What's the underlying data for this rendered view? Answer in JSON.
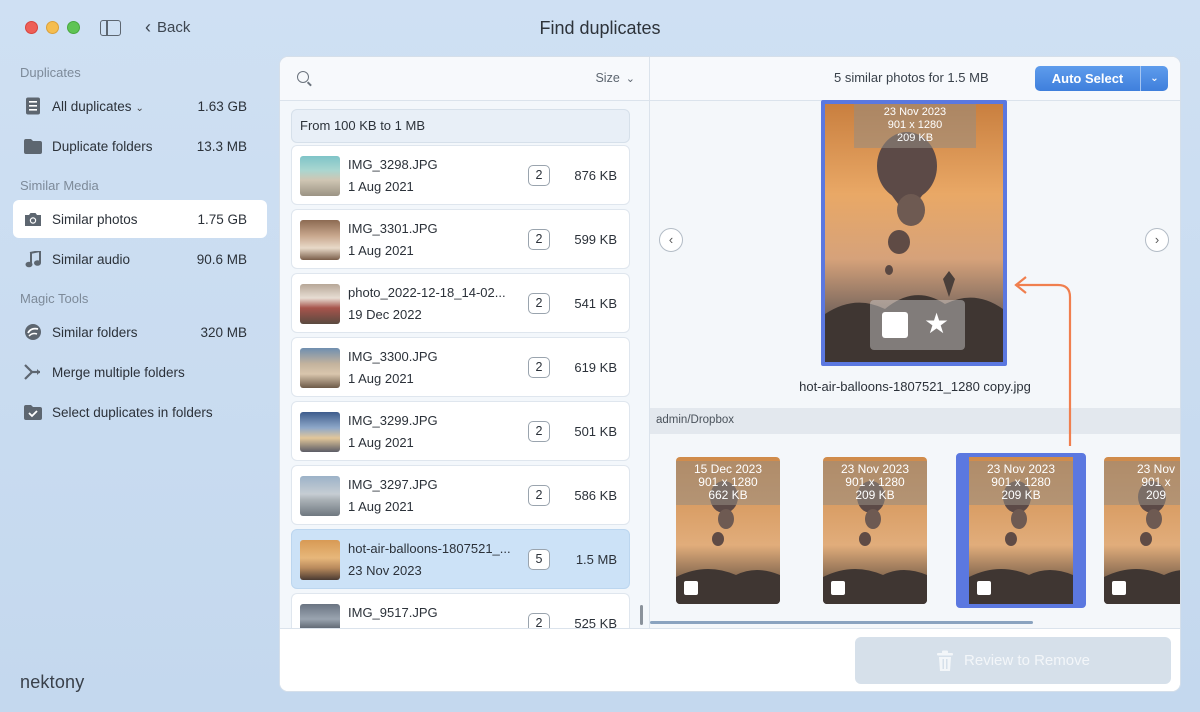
{
  "window": {
    "title": "Find duplicates",
    "back_label": "Back"
  },
  "sidebar": {
    "section_duplicates": "Duplicates",
    "section_similar": "Similar Media",
    "section_magic": "Magic Tools",
    "items": [
      {
        "label": "All duplicates",
        "size": "1.63 GB",
        "icon": "document-list-icon"
      },
      {
        "label": "Duplicate folders",
        "size": "13.3 MB",
        "icon": "folder-icon"
      },
      {
        "label": "Similar photos",
        "size": "1.75 GB",
        "icon": "camera-icon"
      },
      {
        "label": "Similar audio",
        "size": "90.6 MB",
        "icon": "music-note-icon"
      },
      {
        "label": "Similar folders",
        "size": "320 MB",
        "icon": "similar-folders-icon"
      },
      {
        "label": "Merge multiple folders",
        "size": "",
        "icon": "merge-icon"
      },
      {
        "label": "Select duplicates in folders",
        "size": "",
        "icon": "folder-check-icon"
      }
    ],
    "logo": "nektony"
  },
  "list": {
    "sort_label": "Size",
    "range_label": "From 100 KB to 1 MB",
    "files": [
      {
        "name": "IMG_3298.JPG",
        "date": "1 Aug 2021",
        "count": "2",
        "size": "876 KB"
      },
      {
        "name": "IMG_3301.JPG",
        "date": "1 Aug 2021",
        "count": "2",
        "size": "599 KB"
      },
      {
        "name": "photo_2022-12-18_14-02...",
        "date": "19 Dec 2022",
        "count": "2",
        "size": "541 KB"
      },
      {
        "name": "IMG_3300.JPG",
        "date": "1 Aug 2021",
        "count": "2",
        "size": "619 KB"
      },
      {
        "name": "IMG_3299.JPG",
        "date": "1 Aug 2021",
        "count": "2",
        "size": "501 KB"
      },
      {
        "name": "IMG_3297.JPG",
        "date": "1 Aug 2021",
        "count": "2",
        "size": "586 KB"
      },
      {
        "name": "hot-air-balloons-1807521_...",
        "date": "23 Nov 2023",
        "count": "5",
        "size": "1.5 MB"
      },
      {
        "name": "IMG_9517.JPG",
        "date": "",
        "count": "2",
        "size": "525 KB"
      }
    ]
  },
  "preview": {
    "summary": "5 similar photos for 1.5 MB",
    "auto_select_label": "Auto Select",
    "big": {
      "date": "23 Nov 2023",
      "dims": "901 x 1280",
      "size": "209 KB",
      "name": "hot-air-balloons-1807521_1280 copy.jpg"
    },
    "folder": "admin/Dropbox",
    "thumbs": [
      {
        "date": "15 Dec 2023",
        "dims": "901 x 1280",
        "size": "662 KB"
      },
      {
        "date": "23 Nov 2023",
        "dims": "901 x 1280",
        "size": "209 KB"
      },
      {
        "date": "23 Nov 2023",
        "dims": "901 x 1280",
        "size": "209 KB"
      },
      {
        "date": "23 Nov",
        "dims": "901 x",
        "size": "209"
      }
    ]
  },
  "footer": {
    "review_label": "Review to Remove"
  }
}
